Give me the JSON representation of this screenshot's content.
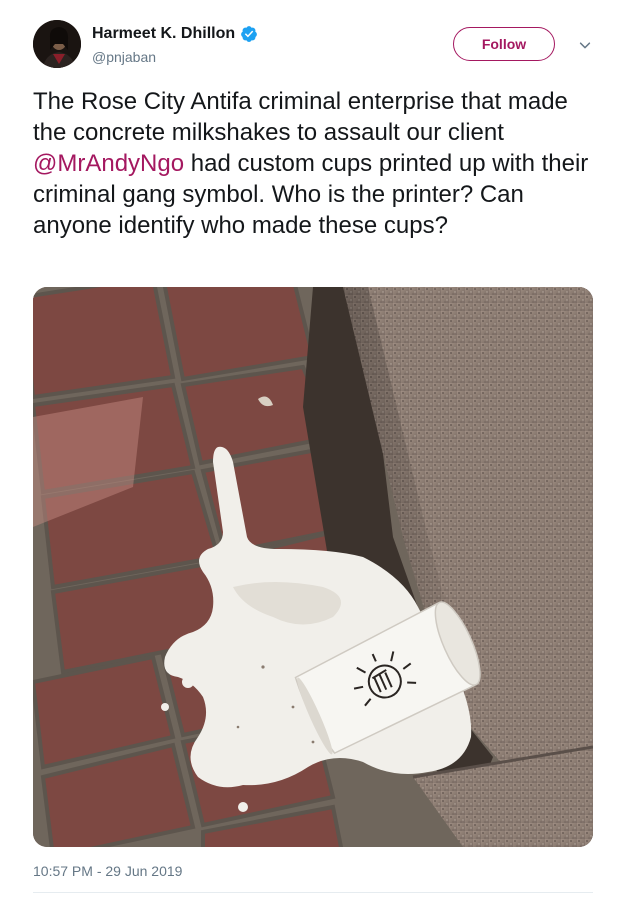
{
  "author": {
    "display_name": "Harmeet K. Dhillon",
    "handle": "@pnjaban",
    "verified": true,
    "avatar_icon": "profile-avatar"
  },
  "follow_button": {
    "label": "Follow",
    "color": "#a41860"
  },
  "caret_icon": "chevron-down-icon",
  "tweet": {
    "text_before": "The Rose City Antifa criminal enterprise that made the concrete milkshakes to assault our client ",
    "mention": "@MrAndyNgo",
    "text_after": " had custom cups printed up with their criminal gang symbol. Who is the printer? Can anyone identify who made these cups?",
    "mention_color": "#a41860"
  },
  "media": {
    "type": "photo",
    "icon": "photo-spilled-cup-on-brick-sidewalk"
  },
  "meta": {
    "timestamp": "10:57 PM - 29 Jun 2019"
  },
  "colors": {
    "text_primary": "#14171a",
    "text_secondary": "#657786",
    "verified_blue": "#1da1f2",
    "divider": "#e6ecf0"
  }
}
